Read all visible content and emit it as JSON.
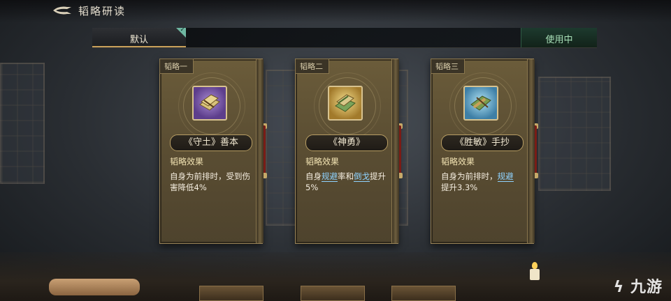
{
  "header": {
    "title": "韬略研读"
  },
  "tabs": {
    "default_label": "默认",
    "status_label": "使用中"
  },
  "cards": [
    {
      "tag": "韬略一",
      "name": "《守土》善本",
      "effect_label": "韬略效果",
      "effect_parts": [
        "自身为前排时，受到伤害降低4%"
      ],
      "icon": "purple-book-bundle-icon"
    },
    {
      "tag": "韬略二",
      "name": "《神勇》",
      "effect_label": "韬略效果",
      "effect_pre": "自身",
      "kw1": "规避",
      "mid": "率和",
      "kw2": "倒戈",
      "post": "提升5%",
      "icon": "gold-book-bundle-icon"
    },
    {
      "tag": "韬略三",
      "name": "《胜敏》手抄",
      "effect_label": "韬略效果",
      "effect_pre": "自身为前排时，",
      "kw1": "规避",
      "post": "提升3.3%",
      "icon": "blue-book-bundle-icon"
    }
  ],
  "watermark": "九游",
  "colors": {
    "accent_gold": "#c9a05a",
    "keyword_blue": "#8fd3ff",
    "in_use_green": "#a9e0b8"
  }
}
